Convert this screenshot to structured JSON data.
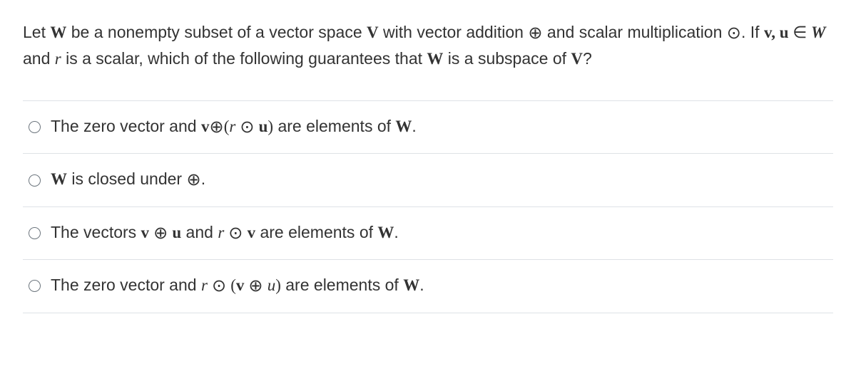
{
  "question": {
    "line1_pre": "Let ",
    "W": "W",
    "line1_mid1": " be a nonempty subset of a vector space ",
    "V": "V",
    "line1_mid2": " with vector addition ",
    "oplus": "⊕",
    "line1_mid3": " and scalar multiplication ",
    "odot": "⊙",
    "line1_mid4": ". If ",
    "vu": "v, u",
    "in": " ∈ ",
    "line1_mid5": " and ",
    "r": "r",
    "line1_mid6": " is a scalar, which of the following guarantees that ",
    "line1_mid7": " is a subspace of ",
    "qmark": "?"
  },
  "options": [
    {
      "pre": "The zero vector and ",
      "expr_v": "v",
      "expr_op1": "⊕",
      "expr_lpar": "(",
      "expr_r": "r",
      "expr_op2": " ⊙ ",
      "expr_u": "u",
      "expr_rpar": ")",
      "post": " are elements of ",
      "W": "W",
      "end": "."
    },
    {
      "pre": "",
      "W": "W",
      "mid": " is closed under ",
      "op": "⊕",
      "end": "."
    },
    {
      "pre": "The vectors ",
      "v": "v",
      "op1": " ⊕ ",
      "u": "u",
      "mid": " and ",
      "r": "r",
      "op2": " ⊙ ",
      "v2": "v",
      "post": " are elements of ",
      "W": "W",
      "end": "."
    },
    {
      "pre": "The zero vector and ",
      "r": "r",
      "op1": " ⊙ ",
      "lpar": "(",
      "v": "v",
      "op2": " ⊕ ",
      "u": "u",
      "rpar": ")",
      "post": " are elements of ",
      "W": "W",
      "end": "."
    }
  ]
}
